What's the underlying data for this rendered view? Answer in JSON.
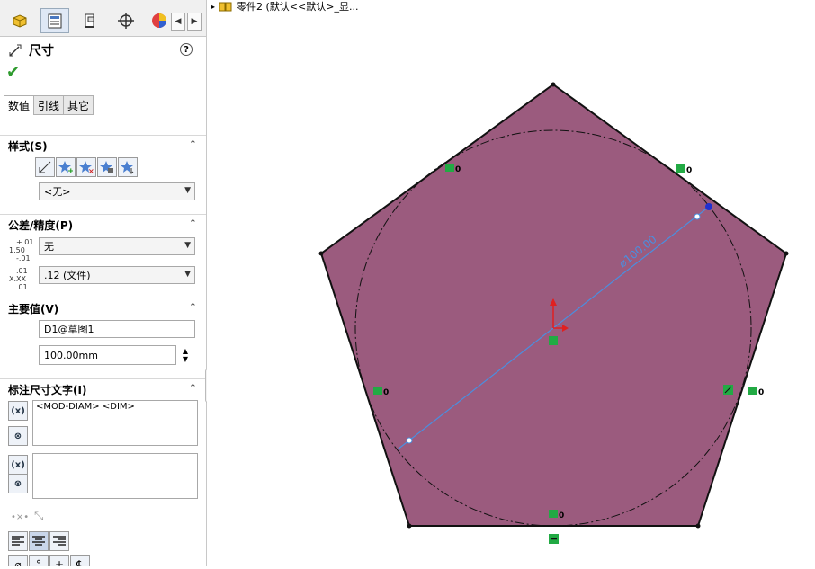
{
  "toolbar": {
    "tabs": [
      {
        "name": "featuremanager-icon"
      },
      {
        "name": "propertymanager-icon"
      },
      {
        "name": "configurationmanager-icon"
      },
      {
        "name": "dimxpertmanager-icon"
      },
      {
        "name": "display-manager-icon"
      }
    ],
    "scroll_left": "◀",
    "scroll_right": "▶"
  },
  "pm": {
    "title": "尺寸",
    "help": "?",
    "ok": "✔",
    "tabs": [
      "数值",
      "引线",
      "其它"
    ]
  },
  "style": {
    "title": "样式(S)",
    "chevron": "⌃",
    "selected": "<无>"
  },
  "tolerance": {
    "title": "公差/精度(P)",
    "chevron": "⌃",
    "tol_icon_top": "+.01",
    "tol_icon_mid": "1.50",
    "tol_icon_bot": "-.01",
    "tol_type": "无",
    "prec_icon_top": ".01",
    "prec_icon_mid": "X.XX",
    "prec_icon_bot": ".01",
    "precision": ".12 (文件)"
  },
  "primary": {
    "title": "主要值(V)",
    "chevron": "⌃",
    "name": "D1@草图1",
    "value": "100.00mm"
  },
  "dimtext": {
    "title": "标注尺寸文字(I)",
    "chevron": "⌃",
    "text1": "<MOD-DIAM> <DIM>",
    "text2": ""
  },
  "bottom": {
    "icon1": "•×•",
    "icon2": "⤡"
  },
  "tree": {
    "label": "零件2 (默认<<默认>_显..."
  },
  "colors": {
    "face": "#9b5b7e",
    "dimension": "#4a8fe0",
    "relation": "#22aa44",
    "origin": "#e02020"
  },
  "sketch": {
    "dimension_label": "⌀100.00",
    "relation_label": "0"
  }
}
